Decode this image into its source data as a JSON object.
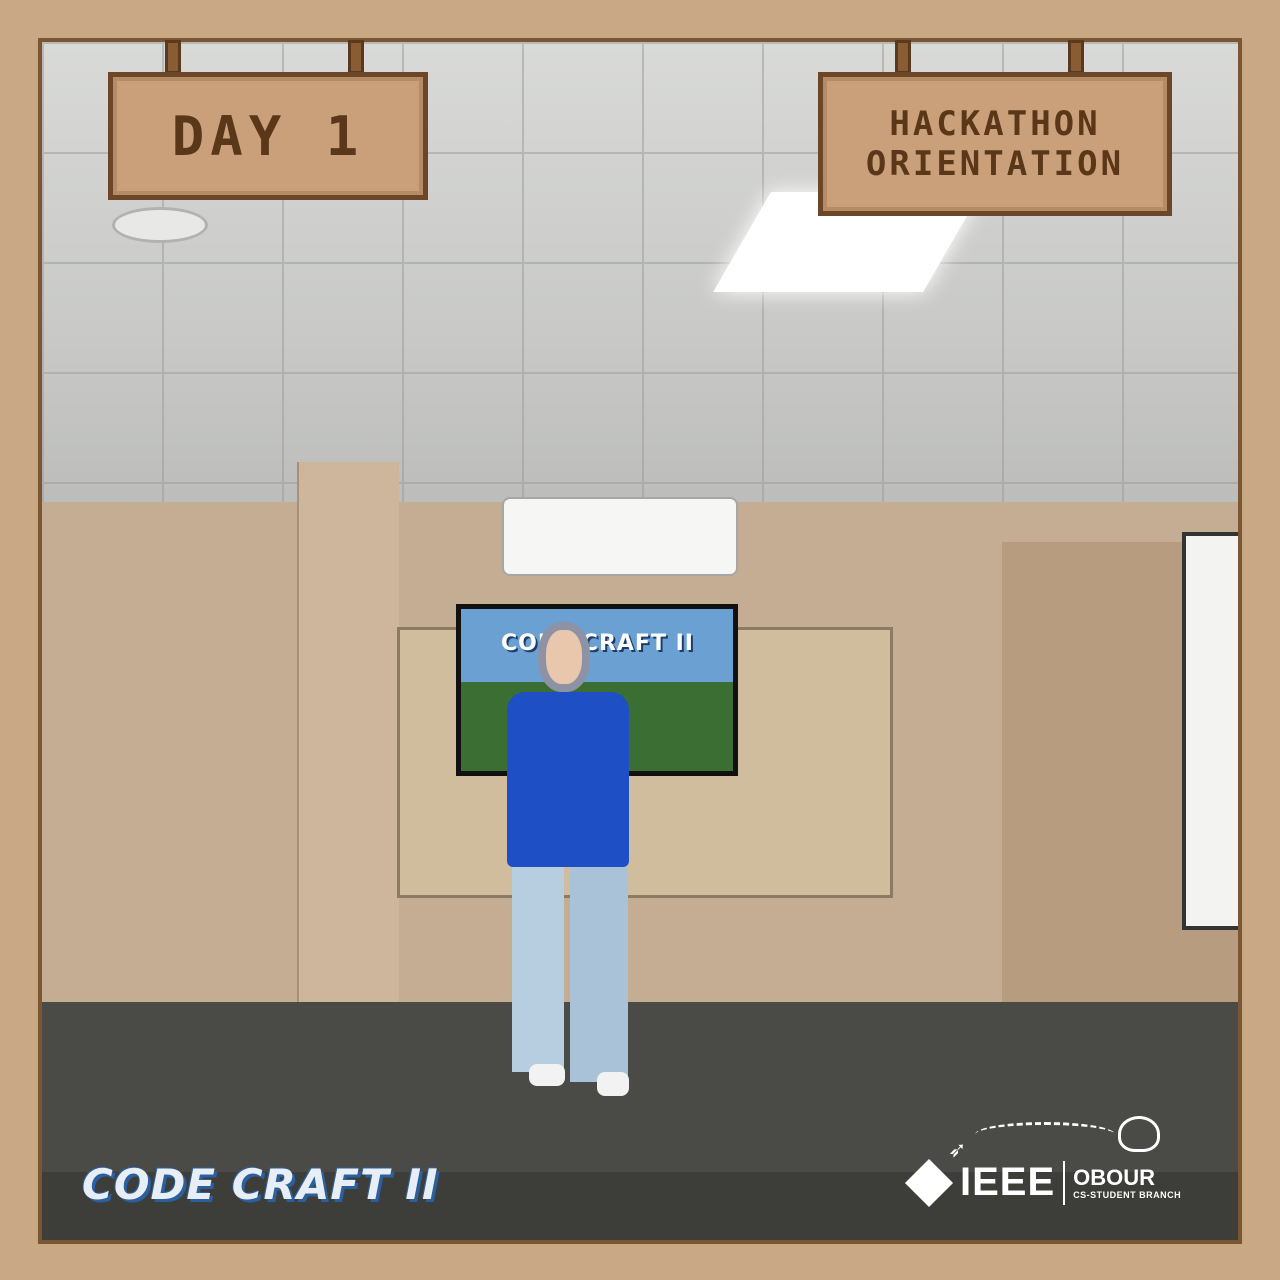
{
  "signs": {
    "day": "DAY 1",
    "event_line1": "HACKATHON",
    "event_line2": "ORIENTATION"
  },
  "screen": {
    "title": "CODE CRAFT II"
  },
  "logos": {
    "codecraft": "CODE CRAFT II",
    "ieee": "IEEE",
    "branch_name": "OBOUR",
    "branch_sub": "CS-STUDENT BRANCH"
  },
  "icons": {
    "rocket": "rocket-icon",
    "server": "server-cloud-icon",
    "ieee": "ieee-diamond-icon"
  },
  "colors": {
    "wood": "#c9a07a",
    "wood_text": "#5a3718",
    "frame_border": "#6b4728",
    "logo_blue": "#2c5f9e",
    "shirt_blue": "#1f4fc4"
  }
}
